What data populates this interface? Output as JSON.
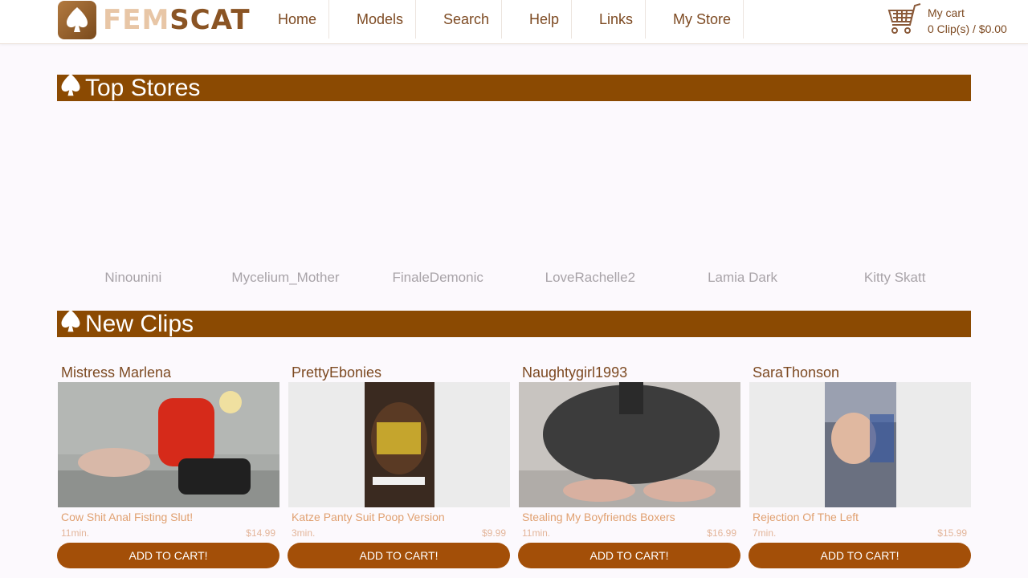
{
  "brand": {
    "fem": "FEM",
    "scat": "SCAT"
  },
  "nav": [
    {
      "label": "Home"
    },
    {
      "label": "Models"
    },
    {
      "label": "Search"
    },
    {
      "label": "Help"
    },
    {
      "label": "Links"
    },
    {
      "label": "My Store"
    }
  ],
  "cart": {
    "title": "My cart",
    "summary": "0 Clip(s) / $0.00"
  },
  "top_stores": {
    "title": "Top Stores",
    "stores": [
      "Ninounini",
      "Mycelium_Mother",
      "FinaleDemonic",
      "LoveRachelle2",
      "Lamia Dark",
      "Kitty Skatt"
    ]
  },
  "new_clips": {
    "title": "New Clips",
    "clips": [
      {
        "author": "Mistress Marlena",
        "title": "Cow Shit Anal Fisting Slut!",
        "duration": "11min.",
        "price": "$14.99",
        "button": "ADD TO CART!"
      },
      {
        "author": "PrettyEbonies",
        "title": "Katze Panty Suit Poop Version",
        "duration": "3min.",
        "price": "$9.99",
        "button": "ADD TO CART!"
      },
      {
        "author": "Naughtygirl1993",
        "title": "Stealing My Boyfriends Boxers",
        "duration": "11min.",
        "price": "$16.99",
        "button": "ADD TO CART!"
      },
      {
        "author": "SaraThonson",
        "title": "Rejection Of The Left",
        "duration": "7min.",
        "price": "$15.99",
        "button": "ADD TO CART!"
      }
    ]
  },
  "colors": {
    "brand_brown": "#8b4a02",
    "button_brown": "#a34f08",
    "nav_text": "#7d4a22",
    "store_text": "#a8a3a8",
    "clip_title": "#e0a070"
  }
}
